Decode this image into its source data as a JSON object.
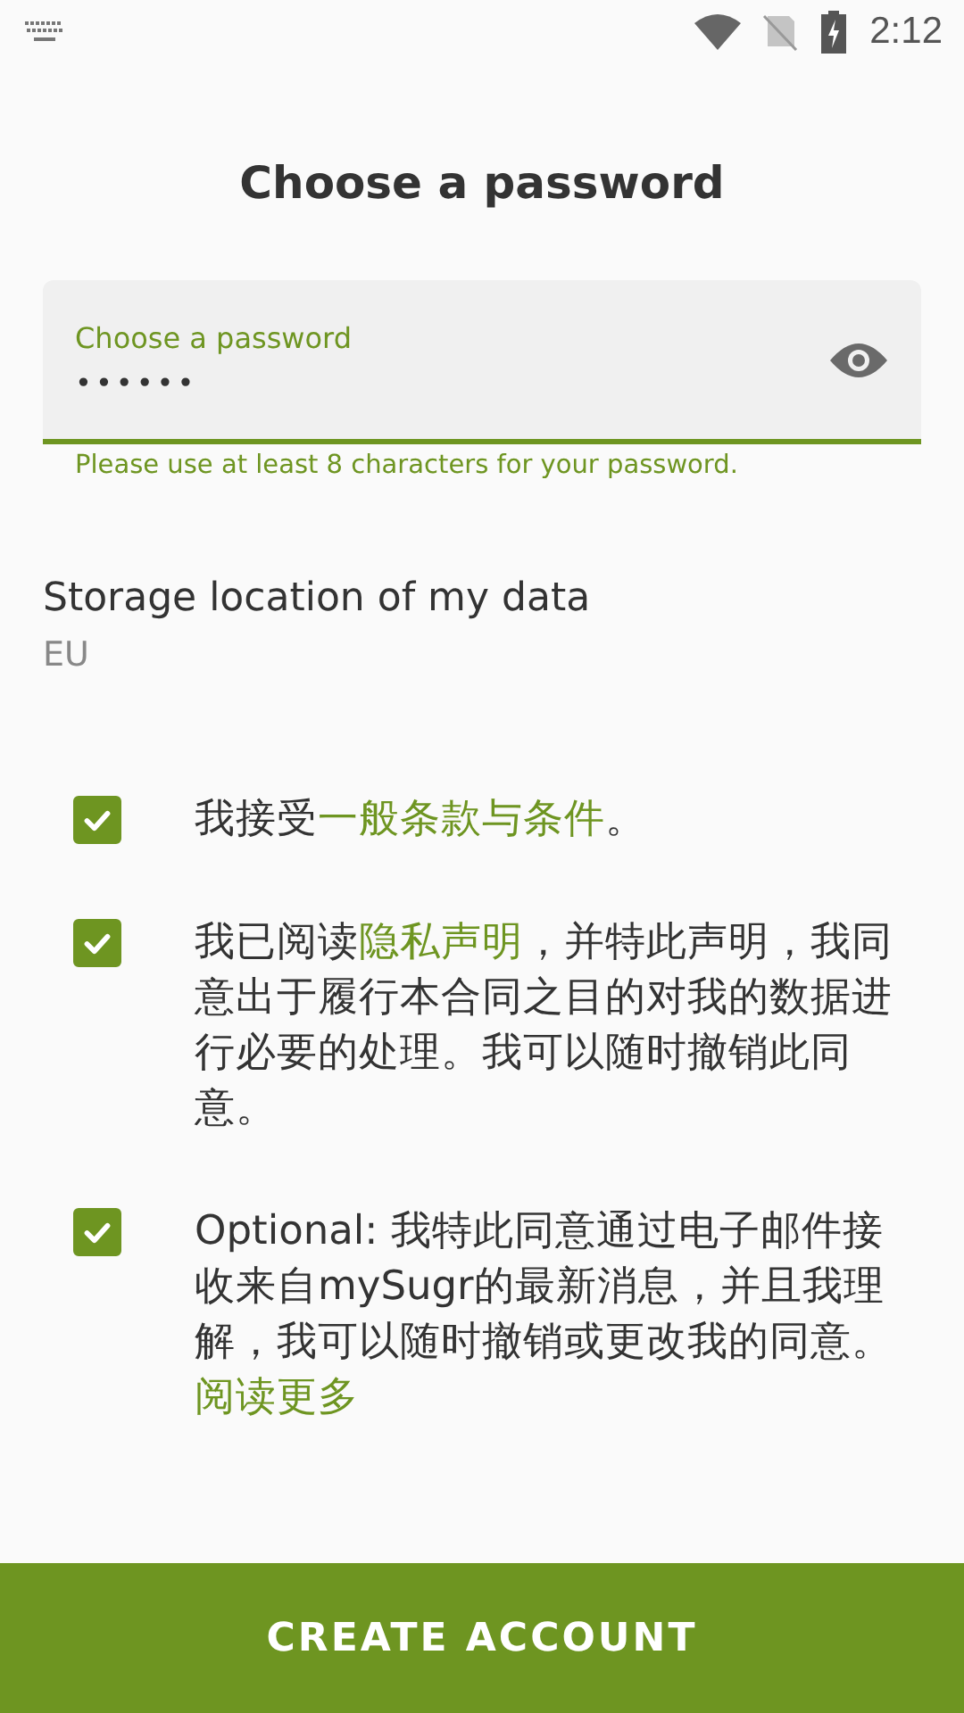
{
  "status_bar": {
    "time": "2:12"
  },
  "title": "Choose a password",
  "password_field": {
    "label": "Choose a password",
    "value": "••••••",
    "helper": "Please use at least 8 characters for your password."
  },
  "storage": {
    "label": "Storage location of my data",
    "value": "EU"
  },
  "consents": [
    {
      "checked": true,
      "before": "我接受",
      "link": "一般条款与条件",
      "after": "。"
    },
    {
      "checked": true,
      "before": "我已阅读",
      "link": "隐私声明",
      "after": "，并特此声明，我同意出于履行本合同之目的对我的数据进行必要的处理。我可以随时撤销此同意。"
    },
    {
      "checked": true,
      "before": "Optional: 我特此同意通过电子邮件接收来自mySugr的最新消息，并且我理解，我可以随时撤销或更改我的同意。",
      "link": "阅读更多"
    }
  ],
  "button": "CREATE ACCOUNT"
}
